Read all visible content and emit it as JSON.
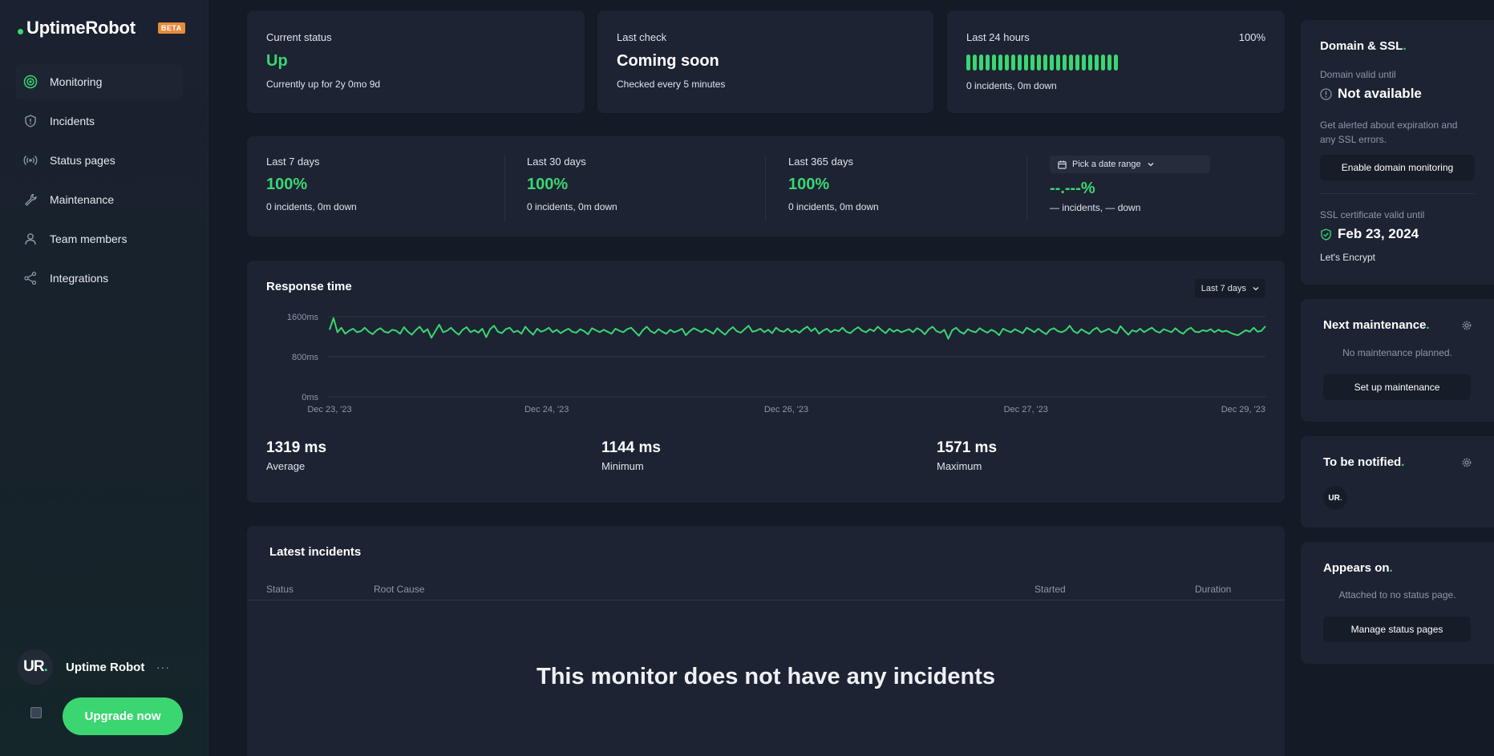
{
  "brand": {
    "name": "UptimeRobot",
    "badge": "BETA"
  },
  "sidebar": {
    "items": [
      {
        "label": "Monitoring",
        "icon": "monitoring-icon",
        "active": true
      },
      {
        "label": "Incidents",
        "icon": "shield-icon"
      },
      {
        "label": "Status pages",
        "icon": "broadcast-icon"
      },
      {
        "label": "Maintenance",
        "icon": "wrench-icon"
      },
      {
        "label": "Team members",
        "icon": "user-icon"
      },
      {
        "label": "Integrations",
        "icon": "share-icon"
      }
    ],
    "user": {
      "initials": "UR",
      "dot": ".",
      "name": "Uptime Robot",
      "menu": "···"
    },
    "upgrade_label": "Upgrade now"
  },
  "status": {
    "current": {
      "label": "Current status",
      "value": "Up",
      "sub": "Currently up for 2y 0mo 9d"
    },
    "last_check": {
      "label": "Last check",
      "value": "Coming soon",
      "sub": "Checked every 5 minutes"
    },
    "last24": {
      "label": "Last 24 hours",
      "percent": "100%",
      "sub": "0 incidents, 0m down",
      "bar_count": 24
    }
  },
  "uptime": {
    "d7": {
      "label": "Last 7 days",
      "value": "100%",
      "sub": "0 incidents, 0m down"
    },
    "d30": {
      "label": "Last 30 days",
      "value": "100%",
      "sub": "0 incidents, 0m down"
    },
    "d365": {
      "label": "Last 365 days",
      "value": "100%",
      "sub": "0 incidents, 0m down"
    },
    "custom": {
      "picker_label": "Pick a date range",
      "value": "--.---%",
      "sub": "— incidents, — down"
    }
  },
  "response": {
    "title": "Response time",
    "range_label": "Last 7 days",
    "stats": [
      {
        "value": "1319 ms",
        "label": "Average"
      },
      {
        "value": "1144 ms",
        "label": "Minimum"
      },
      {
        "value": "1571 ms",
        "label": "Maximum"
      }
    ]
  },
  "chart_data": {
    "type": "line",
    "title": "Response time",
    "xlabel": "",
    "ylabel": "",
    "ylim": [
      0,
      1600
    ],
    "y_ticks": [
      "1600ms",
      "800ms",
      "0ms"
    ],
    "x_ticks": [
      "Dec 23, '23",
      "Dec 24, '23",
      "Dec 26, '23",
      "Dec 27, '23",
      "Dec 29, '23"
    ],
    "grid": true,
    "color": "#3bd671",
    "series": [
      {
        "values": [
          1340,
          1571,
          1290,
          1380,
          1260,
          1320,
          1360,
          1290,
          1310,
          1380,
          1300,
          1250,
          1330,
          1370,
          1300,
          1280,
          1340,
          1320,
          1260,
          1390,
          1300,
          1240,
          1330,
          1400,
          1290,
          1350,
          1180,
          1310,
          1440,
          1290,
          1320,
          1380,
          1300,
          1240,
          1340,
          1390,
          1290,
          1330,
          1280,
          1360,
          1190,
          1350,
          1420,
          1300,
          1270,
          1350,
          1380,
          1290,
          1320,
          1260,
          1400,
          1310,
          1240,
          1360,
          1300,
          1330,
          1380,
          1290,
          1340,
          1270,
          1320,
          1360,
          1300,
          1280,
          1350,
          1310,
          1250,
          1370,
          1330,
          1290,
          1340,
          1300,
          1260,
          1360,
          1320,
          1290,
          1350,
          1380,
          1300,
          1220,
          1330,
          1400,
          1310,
          1270,
          1350,
          1300,
          1260,
          1340,
          1290,
          1320,
          1360,
          1230,
          1310,
          1370,
          1330,
          1290,
          1350,
          1310,
          1260,
          1370,
          1300,
          1240,
          1330,
          1390,
          1310,
          1280,
          1350,
          1420,
          1300,
          1320,
          1360,
          1290,
          1340,
          1270,
          1380,
          1320,
          1300,
          1360,
          1290,
          1330,
          1280,
          1350,
          1400,
          1310,
          1370,
          1260,
          1320,
          1360,
          1290,
          1340,
          1310,
          1380,
          1300,
          1270,
          1340,
          1390,
          1320,
          1290,
          1350,
          1310,
          1400,
          1330,
          1270,
          1360,
          1300,
          1340,
          1290,
          1320,
          1350,
          1290,
          1370,
          1330,
          1250,
          1350,
          1400,
          1310,
          1280,
          1340,
          1160,
          1330,
          1380,
          1300,
          1260,
          1350,
          1310,
          1290,
          1370,
          1320,
          1280,
          1340,
          1300,
          1230,
          1360,
          1320,
          1290,
          1350,
          1310,
          1270,
          1380,
          1340,
          1290,
          1360,
          1300,
          1250,
          1340,
          1370,
          1310,
          1290,
          1330,
          1420,
          1310,
          1270,
          1350,
          1300,
          1260,
          1340,
          1380,
          1290,
          1320,
          1360,
          1300,
          1270,
          1410,
          1320,
          1240,
          1330,
          1300,
          1360,
          1290,
          1340,
          1380,
          1310,
          1280,
          1350,
          1320,
          1290,
          1370,
          1300,
          1260,
          1340,
          1380,
          1300,
          1290,
          1330,
          1310,
          1350,
          1290,
          1340,
          1300,
          1320,
          1280,
          1250,
          1230,
          1280,
          1330,
          1300,
          1380,
          1300,
          1320,
          1410
        ]
      }
    ]
  },
  "incidents": {
    "title": "Latest incidents",
    "columns": [
      "Status",
      "Root Cause",
      "Started",
      "Duration"
    ],
    "empty": "This monitor does not have any incidents"
  },
  "domain": {
    "title": "Domain & SSL",
    "valid_label": "Domain valid until",
    "valid_value": "Not available",
    "alert_text": "Get alerted about expiration and any SSL errors.",
    "enable_label": "Enable domain monitoring",
    "ssl_label": "SSL certificate valid until",
    "ssl_value": "Feb 23, 2024",
    "issuer": "Let's Encrypt"
  },
  "maintenance": {
    "title": "Next maintenance",
    "empty": "No maintenance planned.",
    "button": "Set up maintenance"
  },
  "notify": {
    "title": "To be notified",
    "avatar": "UR"
  },
  "appears": {
    "title": "Appears on",
    "empty": "Attached to no status page.",
    "button": "Manage status pages"
  },
  "dot": "."
}
